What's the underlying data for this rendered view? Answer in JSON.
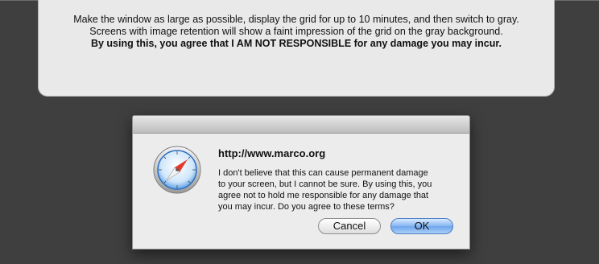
{
  "info_panel": {
    "line1": "Make the window as large as possible, display the grid for up to 10 minutes, and then switch to gray.",
    "line2": "Screens with image retention will show a faint impression of the grid on the gray background.",
    "line3": "By using this, you agree that I AM NOT RESPONSIBLE for any damage you may incur."
  },
  "dialog": {
    "icon": "safari-compass-icon",
    "title": "http://www.marco.org",
    "message_lines": [
      "I don't believe that this can cause permanent damage",
      "to your screen, but I cannot be sure. By using this, you",
      "agree not to hold me responsible for any damage that",
      "you may incur. Do you agree to these terms?"
    ],
    "cancel_label": "Cancel",
    "ok_label": "OK"
  },
  "colors": {
    "background": "#3f3f3f",
    "panel": "#e9e9e9",
    "dialog": "#ececec",
    "default_button": "#86b6f1"
  }
}
